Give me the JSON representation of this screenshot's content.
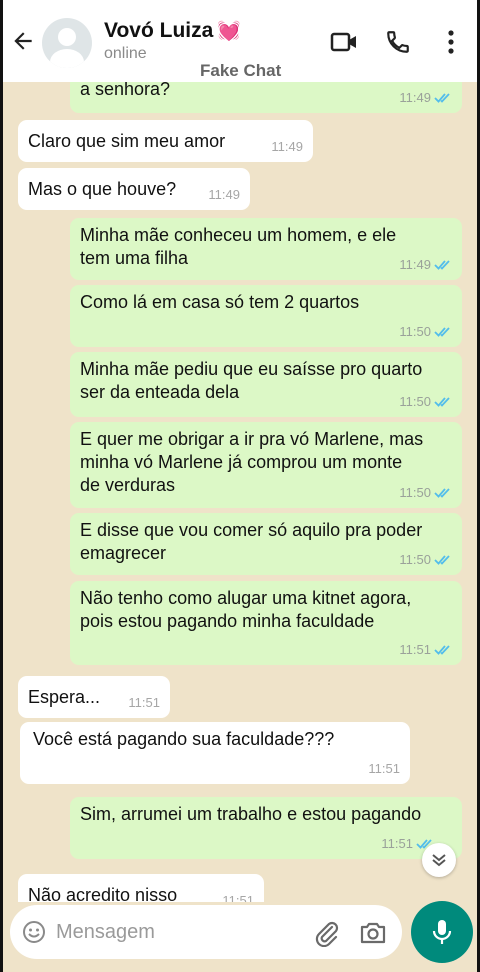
{
  "header": {
    "contact_name": "Vovó Luiza",
    "heart": "💓",
    "status": "online",
    "watermark": "Fake Chat"
  },
  "messages": [
    {
      "dir": "out",
      "lines": [
        "a senhora?"
      ],
      "time": "11:49",
      "ticks": true
    },
    {
      "dir": "in",
      "lines": [
        "Claro que sim meu amor"
      ],
      "time": "11:49"
    },
    {
      "dir": "in",
      "lines": [
        "Mas o que houve?"
      ],
      "time": "11:49"
    },
    {
      "dir": "out",
      "lines": [
        "Minha mãe conheceu um homem, e ele",
        "tem uma filha"
      ],
      "time": "11:49",
      "ticks": true
    },
    {
      "dir": "out",
      "lines": [
        "Como lá em casa só tem 2 quartos"
      ],
      "time": "11:50",
      "ticks": true
    },
    {
      "dir": "out",
      "lines": [
        "Minha mãe pediu que eu saísse pro quarto",
        "ser da enteada dela"
      ],
      "time": "11:50",
      "ticks": true
    },
    {
      "dir": "out",
      "lines": [
        "E quer me obrigar a ir pra vó Marlene, mas",
        "minha vó Marlene já comprou um monte",
        "de verduras"
      ],
      "time": "11:50",
      "ticks": true
    },
    {
      "dir": "out",
      "lines": [
        "E disse que vou comer só aquilo pra poder",
        "emagrecer"
      ],
      "time": "11:50",
      "ticks": true
    },
    {
      "dir": "out",
      "lines": [
        "Não tenho como alugar uma kitnet agora,",
        "pois estou pagando minha faculdade"
      ],
      "time": "11:51",
      "ticks": true
    },
    {
      "dir": "in",
      "lines": [
        "Espera..."
      ],
      "time": "11:51"
    },
    {
      "dir": "in",
      "lines": [
        "Você está pagando sua faculdade???"
      ],
      "time": "11:51"
    },
    {
      "dir": "out",
      "lines": [
        "Sim, arrumei um trabalho e estou pagando"
      ],
      "time": "11:51",
      "ticks": true
    },
    {
      "dir": "in",
      "lines": [
        "Não acredito nisso"
      ],
      "time": "11:51"
    }
  ],
  "composer": {
    "placeholder": "Mensagem"
  },
  "colors": {
    "chat_background": "#efe3c9",
    "outgoing_bubble": "#dcf8c6",
    "incoming_bubble": "#ffffff",
    "read_ticks": "#53bdeb",
    "mic_button": "#008a7c"
  },
  "icons": [
    "back-arrow-icon",
    "avatar-placeholder-icon",
    "heart-icon",
    "video-call-icon",
    "phone-icon",
    "more-menu-icon",
    "double-check-icon",
    "scroll-down-icon",
    "emoji-icon",
    "attach-icon",
    "camera-icon",
    "microphone-icon"
  ]
}
